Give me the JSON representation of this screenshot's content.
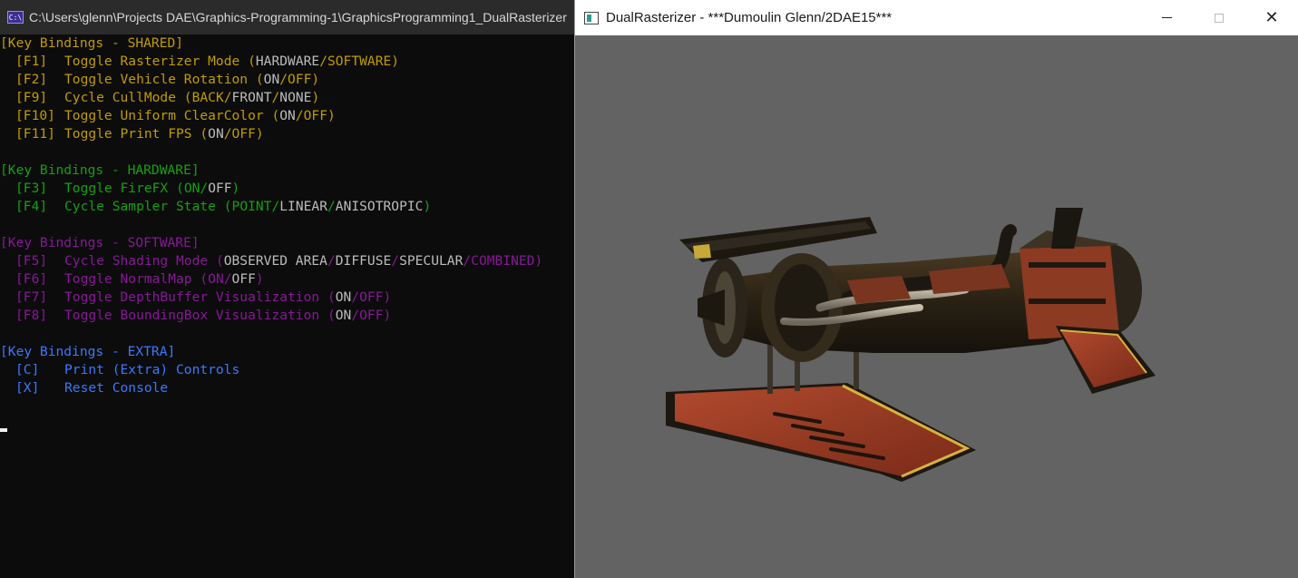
{
  "console": {
    "title": "C:\\Users\\glenn\\Projects DAE\\Graphics-Programming-1\\GraphicsProgramming1_DualRasterizer",
    "icon_label": "C:\\",
    "sections": [
      {
        "header": "[Key Bindings - SHARED]",
        "color": "#c19c00",
        "items": [
          {
            "key": "[F1]",
            "action": "Toggle Rasterizer Mode ",
            "options": [
              "HARDWARE",
              "SOFTWARE"
            ],
            "active": 1
          },
          {
            "key": "[F2]",
            "action": "Toggle Vehicle Rotation ",
            "options": [
              "ON",
              "OFF"
            ],
            "active": 1
          },
          {
            "key": "[F9]",
            "action": "Cycle CullMode ",
            "options": [
              "BACK",
              "FRONT",
              "NONE"
            ],
            "active": 0
          },
          {
            "key": "[F10]",
            "action": "Toggle Uniform ClearColor ",
            "options": [
              "ON",
              "OFF"
            ],
            "active": 1
          },
          {
            "key": "[F11]",
            "action": "Toggle Print FPS ",
            "options": [
              "ON",
              "OFF"
            ],
            "active": 1
          }
        ]
      },
      {
        "header": "[Key Bindings - HARDWARE]",
        "color": "#13a10e",
        "items": [
          {
            "key": "[F3]",
            "action": "Toggle FireFX ",
            "options": [
              "ON",
              "OFF"
            ],
            "active": 0
          },
          {
            "key": "[F4]",
            "action": "Cycle Sampler State ",
            "options": [
              "POINT",
              "LINEAR",
              "ANISOTROPIC"
            ],
            "active": 0
          }
        ]
      },
      {
        "header": "[Key Bindings - SOFTWARE]",
        "color": "#881798",
        "items": [
          {
            "key": "[F5]",
            "action": "Cycle Shading Mode ",
            "options": [
              "OBSERVED AREA",
              "DIFFUSE",
              "SPECULAR",
              "COMBINED"
            ],
            "active": 3
          },
          {
            "key": "[F6]",
            "action": "Toggle NormalMap ",
            "options": [
              "ON",
              "OFF"
            ],
            "active": 0
          },
          {
            "key": "[F7]",
            "action": "Toggle DepthBuffer Visualization ",
            "options": [
              "ON",
              "OFF"
            ],
            "active": 1
          },
          {
            "key": "[F8]",
            "action": "Toggle BoundingBox Visualization ",
            "options": [
              "ON",
              "OFF"
            ],
            "active": 1
          }
        ]
      },
      {
        "header": "[Key Bindings - EXTRA]",
        "color": "#3b78ff",
        "items": [
          {
            "key": "[C]",
            "action": "Print (Extra) Controls",
            "options": [],
            "active": -1
          },
          {
            "key": "[X]",
            "action": "Reset Console",
            "options": [],
            "active": -1
          }
        ]
      }
    ]
  },
  "renderer": {
    "title": "DualRasterizer - ***Dumoulin Glenn/2DAE15***",
    "viewport_color": "#636363",
    "minimize_icon": "minimize-icon",
    "maximize_icon": "maximize-icon",
    "close_icon": "close-icon"
  }
}
